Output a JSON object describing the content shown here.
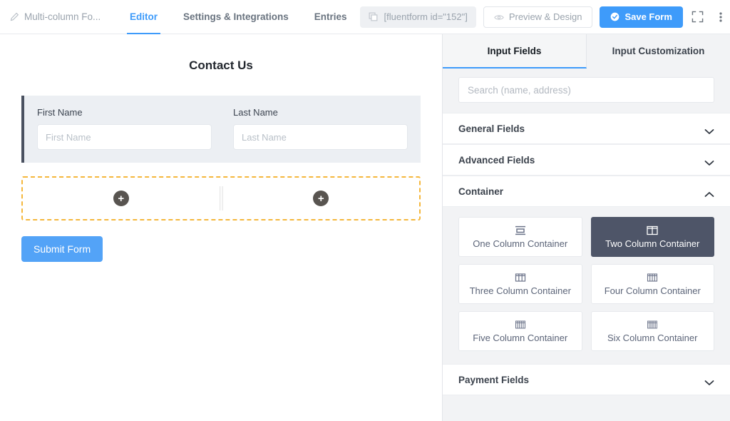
{
  "topbar": {
    "form_name": "Multi-column Fo...",
    "pencil_icon": "pencil-icon",
    "tabs": [
      {
        "label": "Editor",
        "active": true
      },
      {
        "label": "Settings & Integrations",
        "active": false
      },
      {
        "label": "Entries",
        "active": false
      }
    ],
    "shortcode": "[fluentform id=\"152\"]",
    "shortcode_icon": "copy-icon",
    "preview_label": "Preview & Design",
    "preview_icon": "eye-icon",
    "save_label": "Save Form",
    "save_icon": "check-circle-icon",
    "fullscreen_icon": "fullscreen-icon",
    "more_icon": "kebab-menu-icon",
    "accent_color": "#3e9bfa"
  },
  "canvas": {
    "form_heading": "Contact Us",
    "fields": [
      {
        "label": "First Name",
        "placeholder": "First Name",
        "value": ""
      },
      {
        "label": "Last Name",
        "placeholder": "Last Name",
        "value": ""
      }
    ],
    "drop_zone": {
      "add_label": "+",
      "columns": 2,
      "border_color": "#f5b73c"
    },
    "submit_label": "Submit Form",
    "submit_color": "#53a3f7"
  },
  "panel": {
    "tabs": [
      {
        "label": "Input Fields",
        "active": true
      },
      {
        "label": "Input Customization",
        "active": false
      }
    ],
    "search": {
      "placeholder": "Search (name, address)",
      "value": ""
    },
    "sections": [
      {
        "title": "General Fields",
        "expanded": false,
        "chevron": "chevron-down-icon"
      },
      {
        "title": "Advanced Fields",
        "expanded": false,
        "chevron": "chevron-down-icon"
      },
      {
        "title": "Container",
        "expanded": true,
        "chevron": "chevron-up-icon"
      },
      {
        "title": "Payment Fields",
        "expanded": false,
        "chevron": "chevron-down-icon"
      }
    ],
    "containers": [
      {
        "label": "One Column Container",
        "icon": "one-column-icon",
        "selected": false
      },
      {
        "label": "Two Column Container",
        "icon": "two-column-icon",
        "selected": true
      },
      {
        "label": "Three Column Container",
        "icon": "three-column-icon",
        "selected": false
      },
      {
        "label": "Four Column Container",
        "icon": "four-column-icon",
        "selected": false
      },
      {
        "label": "Five Column Container",
        "icon": "five-column-icon",
        "selected": false
      },
      {
        "label": "Six Column Container",
        "icon": "six-column-icon",
        "selected": false
      }
    ],
    "selected_color": "#4e5568"
  }
}
